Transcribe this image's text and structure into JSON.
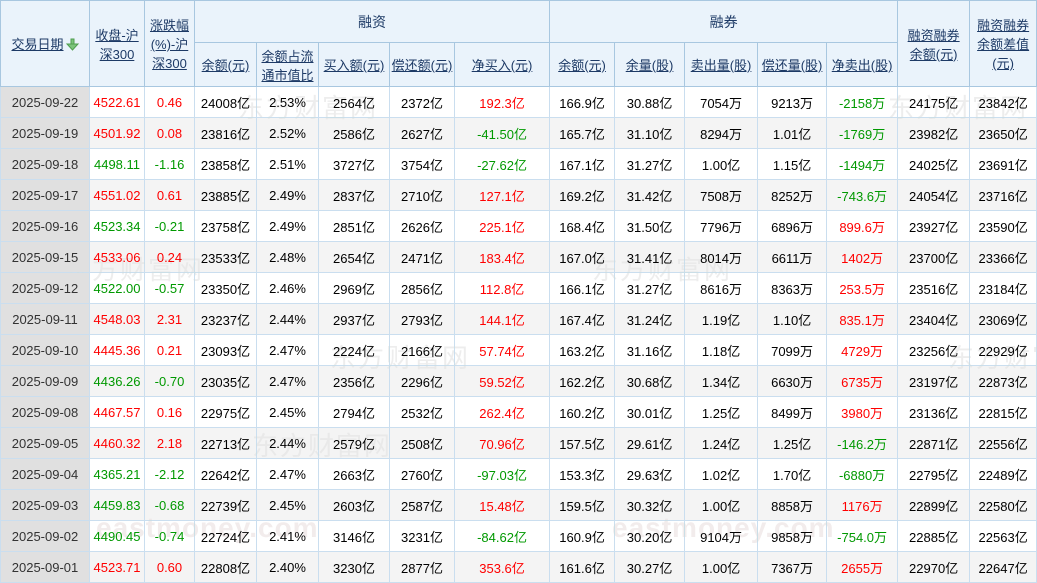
{
  "colors": {
    "up": "#ff0000",
    "down": "#009900",
    "header_text": "#1d3a66",
    "header_bg": "#eaf3fb",
    "date_cell_bg": "#e0e0e0",
    "stripe_bg": "#f4f4f4",
    "border": "#a8c7e0",
    "sort_icon_green": "#7cc47c"
  },
  "icons": {
    "sort": "sort-desc-arrow"
  },
  "watermark": {
    "cn": "东方财富网",
    "en": "eastmoney.com"
  },
  "table": {
    "groups": {
      "financing": "融资",
      "short_selling": "融券"
    },
    "headers": {
      "date": "交易日期",
      "close": "收盘-沪\n深300",
      "change": "涨跌幅\n(%)-沪\n深300",
      "fin_balance": "余额(元)",
      "fin_ratio": "余额占流\n通市值比",
      "fin_buy": "买入额(元)",
      "fin_repay": "偿还额(元)",
      "fin_net": "净买入(元)",
      "sec_balance": "余额(元)",
      "sec_volume": "余量(股)",
      "sec_sell": "卖出量(股)",
      "sec_repay": "偿还量(股)",
      "sec_net": "净卖出(股)",
      "total_balance": "融资融券\n余额(元)",
      "balance_diff": "融资融券\n余额差值\n(元)"
    },
    "rows": [
      {
        "date": "2025-09-22",
        "close": "4522.61",
        "change": "0.46",
        "trend": "up",
        "fin_balance": "24008亿",
        "fin_ratio": "2.53%",
        "fin_buy": "2564亿",
        "fin_repay": "2372亿",
        "fin_net": "192.3亿",
        "fin_net_trend": "up",
        "sec_balance": "166.9亿",
        "sec_volume": "30.88亿",
        "sec_sell": "7054万",
        "sec_repay": "9213万",
        "sec_net": "-2158万",
        "sec_net_trend": "down",
        "total_balance": "24175亿",
        "balance_diff": "23842亿"
      },
      {
        "date": "2025-09-19",
        "close": "4501.92",
        "change": "0.08",
        "trend": "up",
        "fin_balance": "23816亿",
        "fin_ratio": "2.52%",
        "fin_buy": "2586亿",
        "fin_repay": "2627亿",
        "fin_net": "-41.50亿",
        "fin_net_trend": "down",
        "sec_balance": "165.7亿",
        "sec_volume": "31.10亿",
        "sec_sell": "8294万",
        "sec_repay": "1.01亿",
        "sec_net": "-1769万",
        "sec_net_trend": "down",
        "total_balance": "23982亿",
        "balance_diff": "23650亿"
      },
      {
        "date": "2025-09-18",
        "close": "4498.11",
        "change": "-1.16",
        "trend": "down",
        "fin_balance": "23858亿",
        "fin_ratio": "2.51%",
        "fin_buy": "3727亿",
        "fin_repay": "3754亿",
        "fin_net": "-27.62亿",
        "fin_net_trend": "down",
        "sec_balance": "167.1亿",
        "sec_volume": "31.27亿",
        "sec_sell": "1.00亿",
        "sec_repay": "1.15亿",
        "sec_net": "-1494万",
        "sec_net_trend": "down",
        "total_balance": "24025亿",
        "balance_diff": "23691亿"
      },
      {
        "date": "2025-09-17",
        "close": "4551.02",
        "change": "0.61",
        "trend": "up",
        "fin_balance": "23885亿",
        "fin_ratio": "2.49%",
        "fin_buy": "2837亿",
        "fin_repay": "2710亿",
        "fin_net": "127.1亿",
        "fin_net_trend": "up",
        "sec_balance": "169.2亿",
        "sec_volume": "31.42亿",
        "sec_sell": "7508万",
        "sec_repay": "8252万",
        "sec_net": "-743.6万",
        "sec_net_trend": "down",
        "total_balance": "24054亿",
        "balance_diff": "23716亿"
      },
      {
        "date": "2025-09-16",
        "close": "4523.34",
        "change": "-0.21",
        "trend": "down",
        "fin_balance": "23758亿",
        "fin_ratio": "2.49%",
        "fin_buy": "2851亿",
        "fin_repay": "2626亿",
        "fin_net": "225.1亿",
        "fin_net_trend": "up",
        "sec_balance": "168.4亿",
        "sec_volume": "31.50亿",
        "sec_sell": "7796万",
        "sec_repay": "6896万",
        "sec_net": "899.6万",
        "sec_net_trend": "up",
        "total_balance": "23927亿",
        "balance_diff": "23590亿"
      },
      {
        "date": "2025-09-15",
        "close": "4533.06",
        "change": "0.24",
        "trend": "up",
        "fin_balance": "23533亿",
        "fin_ratio": "2.48%",
        "fin_buy": "2654亿",
        "fin_repay": "2471亿",
        "fin_net": "183.4亿",
        "fin_net_trend": "up",
        "sec_balance": "167.0亿",
        "sec_volume": "31.41亿",
        "sec_sell": "8014万",
        "sec_repay": "6611万",
        "sec_net": "1402万",
        "sec_net_trend": "up",
        "total_balance": "23700亿",
        "balance_diff": "23366亿"
      },
      {
        "date": "2025-09-12",
        "close": "4522.00",
        "change": "-0.57",
        "trend": "down",
        "fin_balance": "23350亿",
        "fin_ratio": "2.46%",
        "fin_buy": "2969亿",
        "fin_repay": "2856亿",
        "fin_net": "112.8亿",
        "fin_net_trend": "up",
        "sec_balance": "166.1亿",
        "sec_volume": "31.27亿",
        "sec_sell": "8616万",
        "sec_repay": "8363万",
        "sec_net": "253.5万",
        "sec_net_trend": "up",
        "total_balance": "23516亿",
        "balance_diff": "23184亿"
      },
      {
        "date": "2025-09-11",
        "close": "4548.03",
        "change": "2.31",
        "trend": "up",
        "fin_balance": "23237亿",
        "fin_ratio": "2.44%",
        "fin_buy": "2937亿",
        "fin_repay": "2793亿",
        "fin_net": "144.1亿",
        "fin_net_trend": "up",
        "sec_balance": "167.4亿",
        "sec_volume": "31.24亿",
        "sec_sell": "1.19亿",
        "sec_repay": "1.10亿",
        "sec_net": "835.1万",
        "sec_net_trend": "up",
        "total_balance": "23404亿",
        "balance_diff": "23069亿"
      },
      {
        "date": "2025-09-10",
        "close": "4445.36",
        "change": "0.21",
        "trend": "up",
        "fin_balance": "23093亿",
        "fin_ratio": "2.47%",
        "fin_buy": "2224亿",
        "fin_repay": "2166亿",
        "fin_net": "57.74亿",
        "fin_net_trend": "up",
        "sec_balance": "163.2亿",
        "sec_volume": "31.16亿",
        "sec_sell": "1.18亿",
        "sec_repay": "7099万",
        "sec_net": "4729万",
        "sec_net_trend": "up",
        "total_balance": "23256亿",
        "balance_diff": "22929亿"
      },
      {
        "date": "2025-09-09",
        "close": "4436.26",
        "change": "-0.70",
        "trend": "down",
        "fin_balance": "23035亿",
        "fin_ratio": "2.47%",
        "fin_buy": "2356亿",
        "fin_repay": "2296亿",
        "fin_net": "59.52亿",
        "fin_net_trend": "up",
        "sec_balance": "162.2亿",
        "sec_volume": "30.68亿",
        "sec_sell": "1.34亿",
        "sec_repay": "6630万",
        "sec_net": "6735万",
        "sec_net_trend": "up",
        "total_balance": "23197亿",
        "balance_diff": "22873亿"
      },
      {
        "date": "2025-09-08",
        "close": "4467.57",
        "change": "0.16",
        "trend": "up",
        "fin_balance": "22975亿",
        "fin_ratio": "2.45%",
        "fin_buy": "2794亿",
        "fin_repay": "2532亿",
        "fin_net": "262.4亿",
        "fin_net_trend": "up",
        "sec_balance": "160.2亿",
        "sec_volume": "30.01亿",
        "sec_sell": "1.25亿",
        "sec_repay": "8499万",
        "sec_net": "3980万",
        "sec_net_trend": "up",
        "total_balance": "23136亿",
        "balance_diff": "22815亿"
      },
      {
        "date": "2025-09-05",
        "close": "4460.32",
        "change": "2.18",
        "trend": "up",
        "fin_balance": "22713亿",
        "fin_ratio": "2.44%",
        "fin_buy": "2579亿",
        "fin_repay": "2508亿",
        "fin_net": "70.96亿",
        "fin_net_trend": "up",
        "sec_balance": "157.5亿",
        "sec_volume": "29.61亿",
        "sec_sell": "1.24亿",
        "sec_repay": "1.25亿",
        "sec_net": "-146.2万",
        "sec_net_trend": "down",
        "total_balance": "22871亿",
        "balance_diff": "22556亿"
      },
      {
        "date": "2025-09-04",
        "close": "4365.21",
        "change": "-2.12",
        "trend": "down",
        "fin_balance": "22642亿",
        "fin_ratio": "2.47%",
        "fin_buy": "2663亿",
        "fin_repay": "2760亿",
        "fin_net": "-97.03亿",
        "fin_net_trend": "down",
        "sec_balance": "153.3亿",
        "sec_volume": "29.63亿",
        "sec_sell": "1.02亿",
        "sec_repay": "1.70亿",
        "sec_net": "-6880万",
        "sec_net_trend": "down",
        "total_balance": "22795亿",
        "balance_diff": "22489亿"
      },
      {
        "date": "2025-09-03",
        "close": "4459.83",
        "change": "-0.68",
        "trend": "down",
        "fin_balance": "22739亿",
        "fin_ratio": "2.45%",
        "fin_buy": "2603亿",
        "fin_repay": "2587亿",
        "fin_net": "15.48亿",
        "fin_net_trend": "up",
        "sec_balance": "159.5亿",
        "sec_volume": "30.32亿",
        "sec_sell": "1.00亿",
        "sec_repay": "8858万",
        "sec_net": "1176万",
        "sec_net_trend": "up",
        "total_balance": "22899亿",
        "balance_diff": "22580亿"
      },
      {
        "date": "2025-09-02",
        "close": "4490.45",
        "change": "-0.74",
        "trend": "down",
        "fin_balance": "22724亿",
        "fin_ratio": "2.41%",
        "fin_buy": "3146亿",
        "fin_repay": "3231亿",
        "fin_net": "-84.62亿",
        "fin_net_trend": "down",
        "sec_balance": "160.9亿",
        "sec_volume": "30.20亿",
        "sec_sell": "9104万",
        "sec_repay": "9858万",
        "sec_net": "-754.0万",
        "sec_net_trend": "down",
        "total_balance": "22885亿",
        "balance_diff": "22563亿"
      },
      {
        "date": "2025-09-01",
        "close": "4523.71",
        "change": "0.60",
        "trend": "up",
        "fin_balance": "22808亿",
        "fin_ratio": "2.40%",
        "fin_buy": "3230亿",
        "fin_repay": "2877亿",
        "fin_net": "353.6亿",
        "fin_net_trend": "up",
        "sec_balance": "161.6亿",
        "sec_volume": "30.27亿",
        "sec_sell": "1.00亿",
        "sec_repay": "7367万",
        "sec_net": "2655万",
        "sec_net_trend": "up",
        "total_balance": "22970亿",
        "balance_diff": "22647亿"
      }
    ]
  }
}
